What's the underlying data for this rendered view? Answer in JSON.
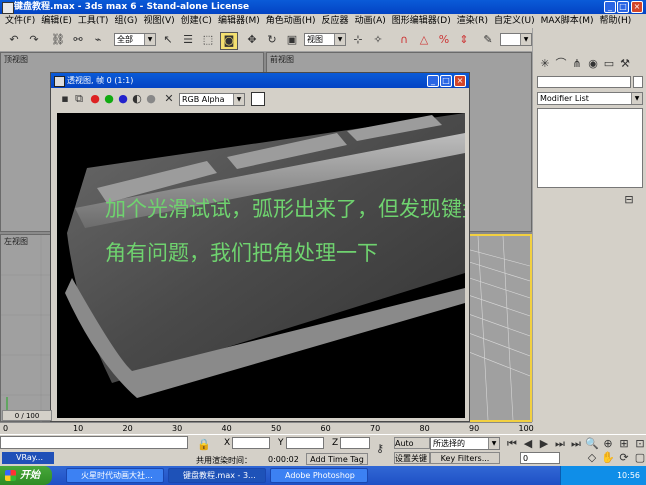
{
  "window": {
    "title": "键盘教程.max - 3ds max 6 - Stand-alone License"
  },
  "menu": [
    "文件(F)",
    "编辑(E)",
    "工具(T)",
    "组(G)",
    "视图(V)",
    "创建(C)",
    "编辑器(M)",
    "角色动画(H)",
    "反应器",
    "动画(A)",
    "图形编辑器(D)",
    "渲染(R)",
    "自定义(U)",
    "MAX脚本(M)",
    "帮助(H)"
  ],
  "toolbar": {
    "selection_filter": "全部",
    "ref_coord": "视图"
  },
  "viewports": {
    "top": "顶视图",
    "front": "前视图",
    "left": "左视图"
  },
  "render_window": {
    "title": "透视图, 帧 0 (1:1)",
    "channel": "RGB Alpha",
    "caption_line1": "加个光滑试试，弧形出来了，但发现键盘的",
    "caption_line2": "角有问题，我们把角处理一下"
  },
  "command_panel": {
    "modifier_list": "Modifier List"
  },
  "timeline": {
    "ticks": [
      "10",
      "20",
      "30",
      "40",
      "50",
      "60",
      "70",
      "80",
      "90",
      "100"
    ],
    "start": "0",
    "slider": "0 / 100"
  },
  "status": {
    "script_listener": "VRay...",
    "x_label": "X",
    "y_label": "Y",
    "z_label": "Z",
    "render_time_label": "共用渲染时间：",
    "render_time": "0:00:02",
    "add_time_tag": "Add Time Tag",
    "auto_key": "Auto Key",
    "set_key": "设置关键点",
    "selected_combo": "所选择的",
    "key_filters": "Key Filters...",
    "frame": "0"
  },
  "taskbar": {
    "start": "开始",
    "tasks": [
      "火星时代动画大社...",
      "键盘教程.max - 3...",
      "Adobe Photoshop"
    ],
    "clock": "10:56"
  }
}
